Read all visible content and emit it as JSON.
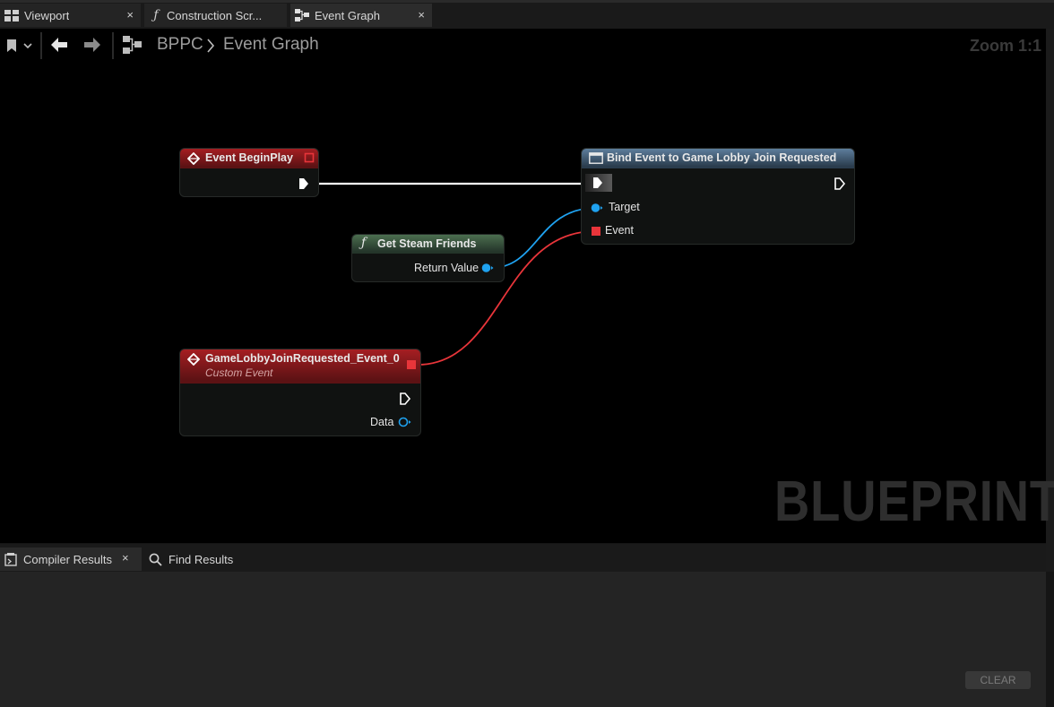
{
  "tabs": [
    {
      "label": "Viewport",
      "icon": "viewport-icon",
      "close": "×"
    },
    {
      "label": "Construction Scr...",
      "icon": "function-icon",
      "close": ""
    },
    {
      "label": "Event Graph",
      "icon": "graph-icon",
      "close": "×"
    }
  ],
  "breadcrumb": {
    "root": "BPPC",
    "current": "Event Graph"
  },
  "zoom": "Zoom 1:1",
  "watermark": "BLUEPRINT",
  "nodes": {
    "begin_play": {
      "title": "Event BeginPlay"
    },
    "bind_event": {
      "title": "Bind Event to Game Lobby Join Requested",
      "pins": [
        "Target",
        "Event"
      ]
    },
    "get_steam": {
      "title": "Get Steam Friends",
      "output": "Return Value"
    },
    "custom_event": {
      "title": "GameLobbyJoinRequested_Event_0",
      "subtitle": "Custom Event",
      "output": "Data"
    }
  },
  "bottom": {
    "tabs": [
      {
        "label": "Compiler Results",
        "close": "×"
      },
      {
        "label": "Find Results"
      }
    ],
    "clear_label": "CLEAR"
  },
  "colors": {
    "exec_wire": "#ffffff",
    "object_pin": "#1fa2f0",
    "delegate_pin": "#e8353a"
  }
}
